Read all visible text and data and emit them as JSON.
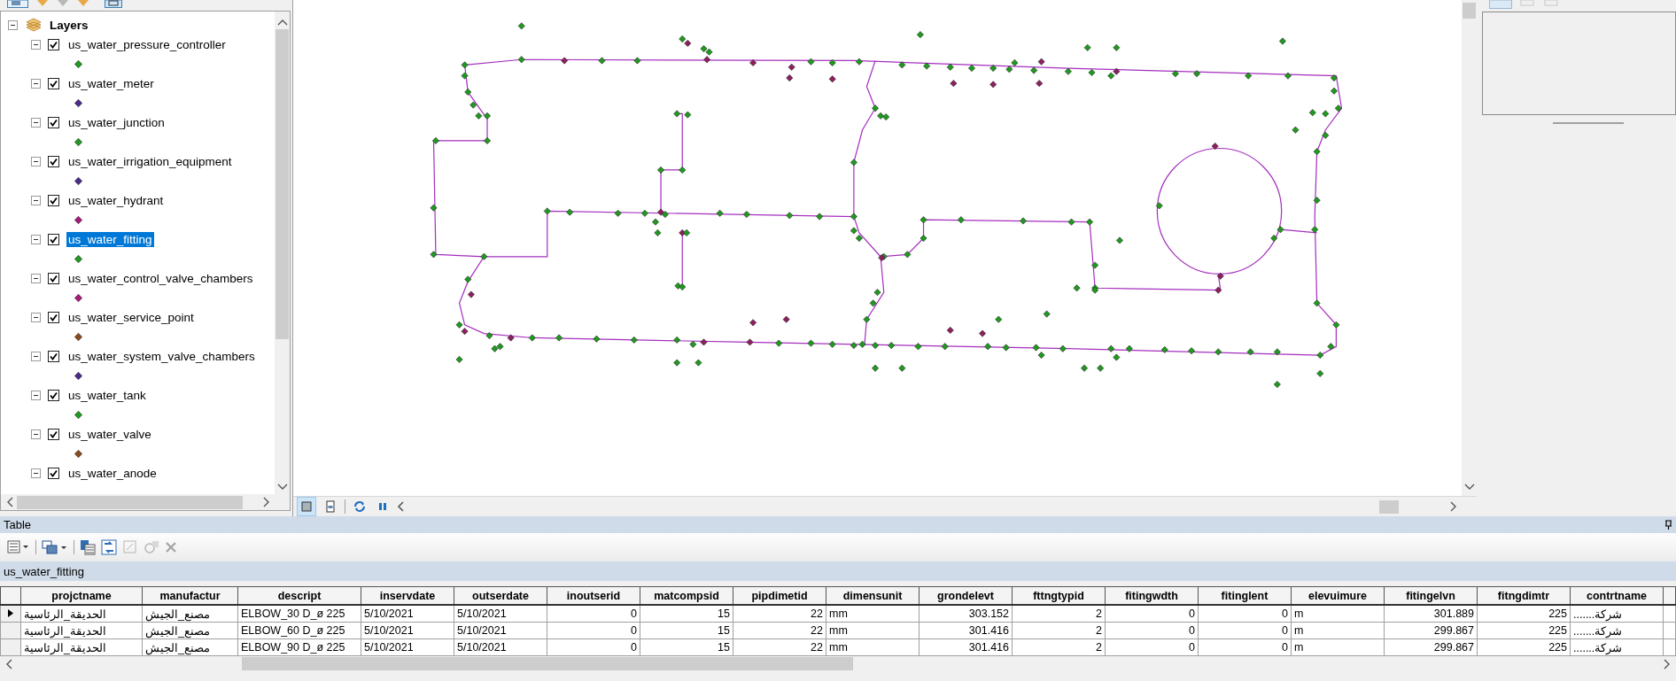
{
  "toc": {
    "root": {
      "label": "Layers",
      "expanded": true
    },
    "layers": [
      {
        "name": "us_water_pressure_controller",
        "expanded": true,
        "checked": true,
        "selected": false,
        "color": "#1f9a1f"
      },
      {
        "name": "us_water_meter",
        "expanded": true,
        "checked": true,
        "selected": false,
        "color": "#4b2a8c"
      },
      {
        "name": "us_water_junction",
        "expanded": true,
        "checked": true,
        "selected": false,
        "color": "#1f9a1f"
      },
      {
        "name": "us_water_irrigation_equipment",
        "expanded": true,
        "checked": true,
        "selected": false,
        "color": "#4b2a8c"
      },
      {
        "name": "us_water_hydrant",
        "expanded": true,
        "checked": true,
        "selected": false,
        "color": "#a8197a"
      },
      {
        "name": "us_water_fitting",
        "expanded": true,
        "checked": true,
        "selected": true,
        "color": "#1f9a1f"
      },
      {
        "name": "us_water_control_valve_chambers",
        "expanded": true,
        "checked": true,
        "selected": false,
        "color": "#a8197a"
      },
      {
        "name": "us_water_service_point",
        "expanded": true,
        "checked": true,
        "selected": false,
        "color": "#8b4a1c"
      },
      {
        "name": "us_water_system_valve_chambers",
        "expanded": true,
        "checked": true,
        "selected": false,
        "color": "#4b2a8c"
      },
      {
        "name": "us_water_tank",
        "expanded": true,
        "checked": true,
        "selected": false,
        "color": "#1f9a1f"
      },
      {
        "name": "us_water_valve",
        "expanded": true,
        "checked": true,
        "selected": false,
        "color": "#8b4a1c"
      },
      {
        "name": "us_water_anode",
        "expanded": true,
        "checked": true,
        "selected": false
      }
    ]
  },
  "table_window": {
    "title": "Table",
    "layer_name": "us_water_fitting",
    "columns": [
      {
        "name": "projctname",
        "kind": "text"
      },
      {
        "name": "manufactur",
        "kind": "text"
      },
      {
        "name": "descript",
        "kind": "text"
      },
      {
        "name": "inservdate",
        "kind": "text"
      },
      {
        "name": "outserdate",
        "kind": "text"
      },
      {
        "name": "inoutserid",
        "kind": "number"
      },
      {
        "name": "matcompsid",
        "kind": "number"
      },
      {
        "name": "pipdimetid",
        "kind": "number"
      },
      {
        "name": "dimensunit",
        "kind": "text"
      },
      {
        "name": "grondelevt",
        "kind": "number"
      },
      {
        "name": "fttngtypid",
        "kind": "number"
      },
      {
        "name": "fitingwdth",
        "kind": "number"
      },
      {
        "name": "fitinglent",
        "kind": "number"
      },
      {
        "name": "elevuimure",
        "kind": "text"
      },
      {
        "name": "fitingelvn",
        "kind": "number"
      },
      {
        "name": "fitngdimtr",
        "kind": "number"
      },
      {
        "name": "contrtname",
        "kind": "text"
      }
    ],
    "rows": [
      {
        "selected": true,
        "cells": [
          "الحديقة_الرئاسية",
          "مصنع_الجيش",
          "ELBOW_30 D_ø 225",
          "5/10/2021",
          "5/10/2021",
          "0",
          "15",
          "22",
          "mm",
          "303.152",
          "2",
          "0",
          "0",
          "m",
          "301.889",
          "225",
          "شركة......."
        ]
      },
      {
        "selected": false,
        "cells": [
          "الحديقة_الرئاسية",
          "مصنع_الجيش",
          "ELBOW_60 D_ø 225",
          "5/10/2021",
          "5/10/2021",
          "0",
          "15",
          "22",
          "mm",
          "301.416",
          "2",
          "0",
          "0",
          "m",
          "299.867",
          "225",
          "شركة......."
        ]
      },
      {
        "selected": false,
        "cells": [
          "الحديقة_الرئاسية",
          "مصنع_الجيش",
          "ELBOW_90 D_ø 225",
          "5/10/2021",
          "5/10/2021",
          "0",
          "15",
          "22",
          "mm",
          "301.416",
          "2",
          "0",
          "0",
          "m",
          "299.867",
          "225",
          "شركة......."
        ]
      }
    ]
  }
}
